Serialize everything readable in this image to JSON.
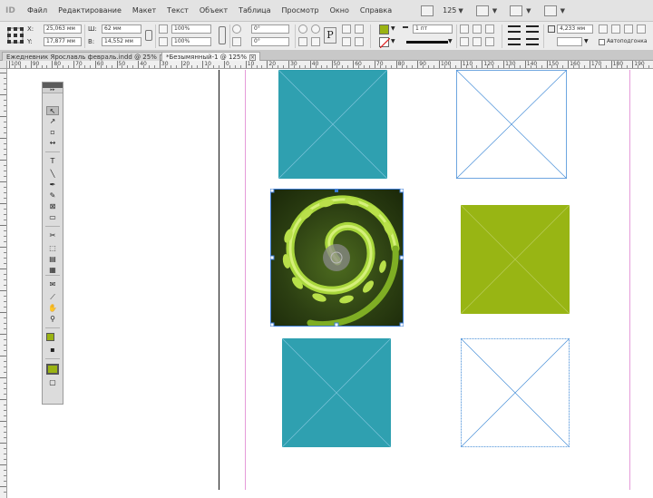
{
  "app": {
    "logo_text": "ID",
    "menu": [
      "Файл",
      "Редактирование",
      "Макет",
      "Текст",
      "Объект",
      "Таблица",
      "Просмотр",
      "Окно",
      "Справка"
    ],
    "zoom_display": "125"
  },
  "control_panel": {
    "x_label": "X:",
    "x_value": "25,063 мм",
    "y_label": "Y:",
    "y_value": "17,877 мм",
    "w_label": "Ш:",
    "w_value": "62 мм",
    "h_label": "В:",
    "h_value": "14,552 мм",
    "scale_x": "100%",
    "scale_y": "100%",
    "rotate": "0°",
    "shear": "0°",
    "stroke_weight": "1 пт",
    "offset_value": "4,233 мм",
    "auto_fit_label": "Автоподгонка",
    "fill_color": "#9ab312"
  },
  "tabs": [
    {
      "label": "Ежедневник Ярославль февраль.indd @ 25%"
    },
    {
      "label": "*Безымянный-1 @ 125%"
    }
  ],
  "ruler": {
    "h_labels": [
      "100",
      "90",
      "80",
      "70",
      "60",
      "50",
      "40",
      "30",
      "20",
      "10",
      "0",
      "10",
      "20",
      "30",
      "40",
      "50",
      "60",
      "70",
      "80",
      "90",
      "100",
      "110",
      "120",
      "130",
      "140",
      "150",
      "160",
      "170",
      "180",
      "190"
    ]
  },
  "colors": {
    "teal": "#2fa0b0",
    "green": "#98b514",
    "page_edge": "#111111",
    "margin": "#e59bd9",
    "frame_line": "#4a90d9"
  },
  "tools": [
    {
      "icon": "selection-icon",
      "glyph": "↖"
    },
    {
      "icon": "direct-selection-icon",
      "glyph": "↗"
    },
    {
      "icon": "page-tool-icon",
      "glyph": "▫"
    },
    {
      "icon": "gap-tool-icon",
      "glyph": "↔"
    },
    {
      "icon": "type-tool-icon",
      "glyph": "T"
    },
    {
      "icon": "line-tool-icon",
      "glyph": "╲"
    },
    {
      "icon": "pen-tool-icon",
      "glyph": "✒"
    },
    {
      "icon": "pencil-tool-icon",
      "glyph": "✎"
    },
    {
      "icon": "rectangle-frame-icon",
      "glyph": "⊠"
    },
    {
      "icon": "rectangle-tool-icon",
      "glyph": "▭"
    },
    {
      "icon": "scissors-icon",
      "glyph": "✂"
    },
    {
      "icon": "free-transform-icon",
      "glyph": "⬚"
    },
    {
      "icon": "gradient-swatch-icon",
      "glyph": "▤"
    },
    {
      "icon": "gradient-feather-icon",
      "glyph": "▦"
    },
    {
      "icon": "note-tool-icon",
      "glyph": "✉"
    },
    {
      "icon": "eyedropper-icon",
      "glyph": "⟋"
    },
    {
      "icon": "hand-tool-icon",
      "glyph": "✋"
    },
    {
      "icon": "zoom-tool-icon",
      "glyph": "⚲"
    },
    {
      "icon": "fill-stroke-icon",
      "glyph": "■"
    },
    {
      "icon": "apply-color-icon",
      "glyph": "▪"
    },
    {
      "icon": "normal-view-icon",
      "glyph": "▣"
    },
    {
      "icon": "screen-mode-icon",
      "glyph": "▢"
    }
  ]
}
